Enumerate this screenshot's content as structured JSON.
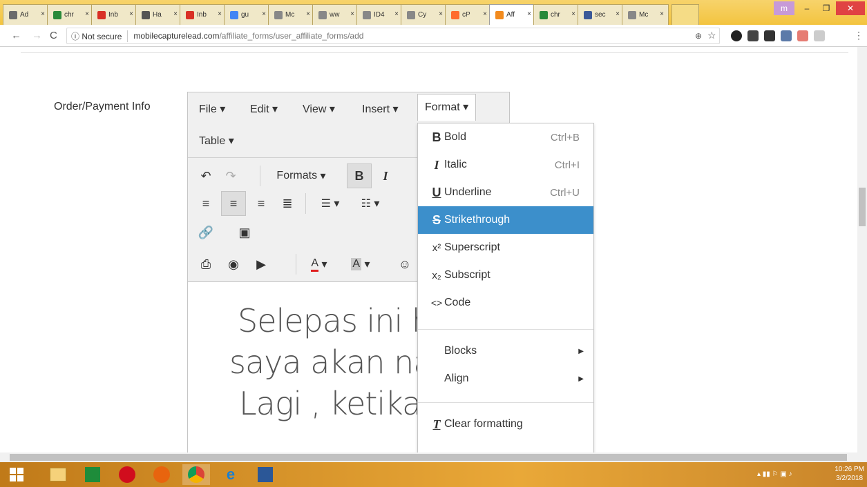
{
  "browser": {
    "tabs": [
      {
        "label": "Ad",
        "fav": "#6b6b6b"
      },
      {
        "label": "chr",
        "fav": "#2a8a3a"
      },
      {
        "label": "Inb",
        "fav": "#d93025"
      },
      {
        "label": "Ha",
        "fav": "#555555"
      },
      {
        "label": "Inb",
        "fav": "#d93025"
      },
      {
        "label": "gu",
        "fav": "#4285f4"
      },
      {
        "label": "Mc",
        "fav": "#888888"
      },
      {
        "label": "ww",
        "fav": "#888888"
      },
      {
        "label": "ID4",
        "fav": "#888888"
      },
      {
        "label": "Cy",
        "fav": "#888888"
      },
      {
        "label": "cP",
        "fav": "#ff6c2c"
      },
      {
        "label": "Aff",
        "fav": "#f28b1e"
      },
      {
        "label": "chr",
        "fav": "#2a8a3a"
      },
      {
        "label": "sec",
        "fav": "#3b5998"
      },
      {
        "label": "Mc",
        "fav": "#888888"
      }
    ],
    "profile_label": "m",
    "security_label": "Not secure",
    "url_host": "mobilecapturelead.com",
    "url_path": "/affiliate_forms/user_affiliate_forms/add"
  },
  "form": {
    "field_label": "Order/Payment Info"
  },
  "editor": {
    "menus": [
      "File",
      "Edit",
      "View",
      "Insert",
      "Format",
      "Table"
    ],
    "formats_label": "Formats",
    "content_lines": [
      "Selepas ini ha",
      "saya akan naik",
      "Lagi , ketika ini"
    ]
  },
  "format_menu": {
    "items": [
      {
        "icon": "B",
        "label": "Bold",
        "shortcut": "Ctrl+B"
      },
      {
        "icon": "I",
        "label": "Italic",
        "shortcut": "Ctrl+I"
      },
      {
        "icon": "U",
        "label": "Underline",
        "shortcut": "Ctrl+U"
      },
      {
        "icon": "S",
        "label": "Strikethrough",
        "shortcut": ""
      },
      {
        "icon": "x²",
        "label": "Superscript",
        "shortcut": ""
      },
      {
        "icon": "x₂",
        "label": "Subscript",
        "shortcut": ""
      },
      {
        "icon": "<>",
        "label": "Code",
        "shortcut": ""
      }
    ],
    "submenus": [
      "Blocks",
      "Align"
    ],
    "clear_label": "Clear formatting",
    "highlight_color": "#3c8fcb"
  },
  "taskbar": {
    "time": "10:26 PM",
    "date": "3/2/2018"
  }
}
